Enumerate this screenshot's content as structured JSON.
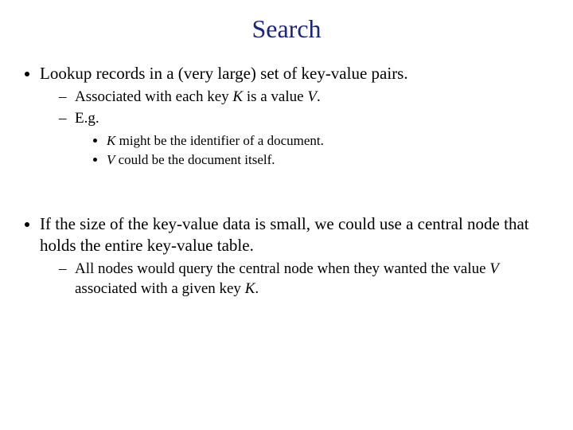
{
  "title": "Search",
  "bullets": {
    "b1": "Lookup records in a (very large) set of key-value pairs.",
    "b1a_pre": "Associated with each key ",
    "b1a_k": "K",
    "b1a_mid": " is a value ",
    "b1a_v": "V",
    "b1a_post": ".",
    "b1b": "E.g.",
    "b1b1_k": "K",
    "b1b1_post": " might be the identifier of a document.",
    "b1b2_v": "V",
    "b1b2_post": " could be the document itself.",
    "b2": "If the size of the key-value data is small, we could use a central node that holds the entire key-value table.",
    "b2a_pre": "All nodes would query the central node when they wanted the value ",
    "b2a_v": "V",
    "b2a_mid": " associated with a given key ",
    "b2a_k": "K",
    "b2a_post": "."
  }
}
